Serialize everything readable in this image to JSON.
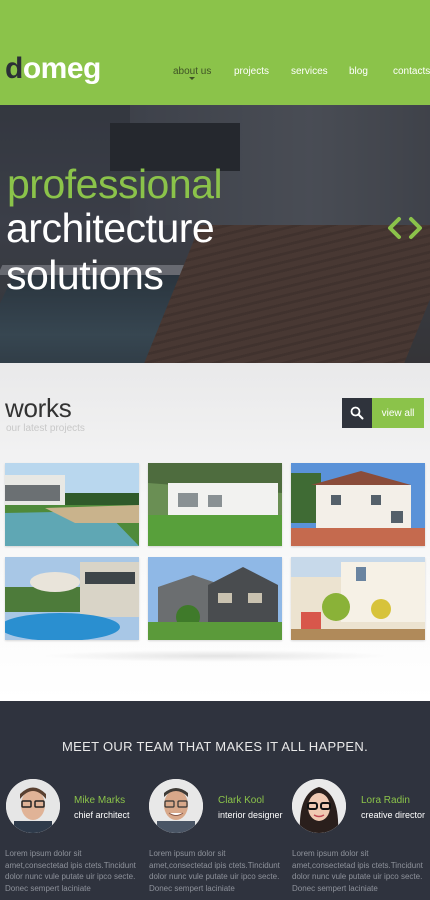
{
  "header": {
    "logo_first": "d",
    "logo_rest": "omeg",
    "nav": [
      "about us",
      "projects",
      "services",
      "blog",
      "contacts"
    ]
  },
  "hero": {
    "line1": "professional",
    "line2": "architecture",
    "line3": "solutions"
  },
  "works": {
    "title": "works",
    "subtitle": "our latest projects",
    "view_all": "view all"
  },
  "team": {
    "heading": "MEET OUR TEAM THAT MAKES IT ALL HAPPEN.",
    "members": [
      {
        "name": "Mike Marks",
        "role": "chief architect",
        "text": "Lorem ipsum dolor sit amet,consectetad ipis ctets.Tincidunt dolor nunc vule putate uir ipco secte. Donec sempert laciniate"
      },
      {
        "name": "Clark Kool",
        "role": "interior designer",
        "text": "Lorem ipsum dolor sit amet,consectetad ipis ctets.Tincidunt dolor nunc vule putate uir ipco secte. Donec sempert laciniate"
      },
      {
        "name": "Lora Radin",
        "role": "creative director",
        "text": "Lorem ipsum dolor sit amet,consectetad ipis ctets.Tincidunt dolor nunc vule putate uir ipco secte. Donec sempert laciniate"
      }
    ]
  },
  "colors": {
    "accent": "#8bc34a",
    "dark": "#2f333e"
  }
}
